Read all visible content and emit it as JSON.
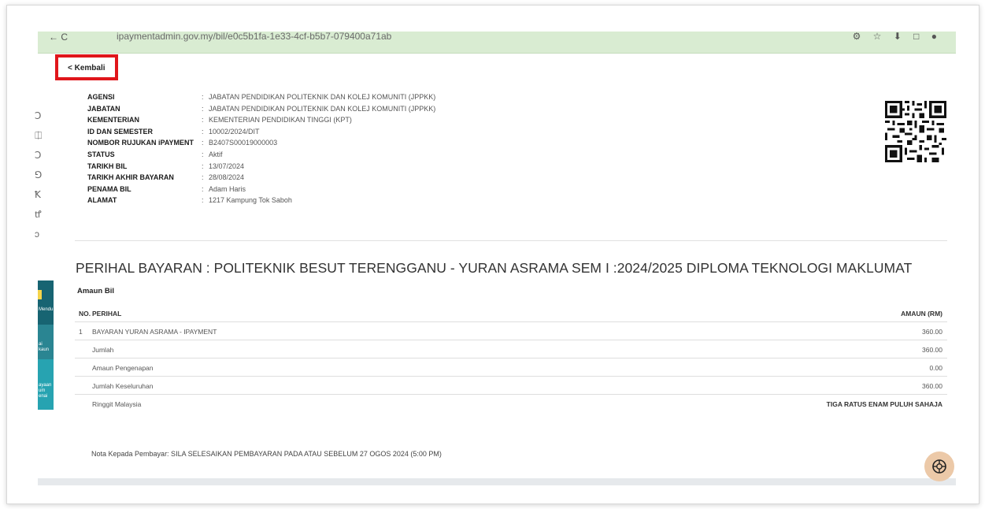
{
  "browser": {
    "nav_left": "←  C",
    "url": "ipaymentadmin.gov.my/bil/e0c5b1fa-1e33-4cf-b5b7-079400a71ab",
    "toolbar_right": "⚙ ☆ ⬇ □ ●"
  },
  "sidebar": {
    "icons": [
      "Ↄ",
      "⎅",
      "Ↄ",
      "⅁",
      "Ꝁ",
      "ꝷ",
      "ↄ"
    ],
    "panel_labels": [
      "Mendu",
      "ai\nkaun",
      "ayaan\num\nenai"
    ]
  },
  "back": {
    "label": "Kembali",
    "icon": "chevron-left-icon"
  },
  "info": [
    {
      "label": "AGENSI",
      "value": "JABATAN PENDIDIKAN POLITEKNIK DAN KOLEJ KOMUNITI (JPPKK)"
    },
    {
      "label": "JABATAN",
      "value": "JABATAN PENDIDIKAN POLITEKNIK DAN KOLEJ KOMUNITI (JPPKK)"
    },
    {
      "label": "KEMENTERIAN",
      "value": "KEMENTERIAN PENDIDIKAN TINGGI (KPT)"
    },
    {
      "label": "ID DAN SEMESTER",
      "value": "10002/2024/DIT"
    },
    {
      "label": "NOMBOR RUJUKAN iPAYMENT",
      "value": "B2407S00019000003"
    },
    {
      "label": "STATUS",
      "value": "Aktif"
    },
    {
      "label": "TARIKH BIL",
      "value": "13/07/2024"
    },
    {
      "label": "TARIKH AKHIR BAYARAN",
      "value": "28/08/2024"
    },
    {
      "label": "PENAMA BIL",
      "value": "Adam Haris"
    },
    {
      "label": "ALAMAT",
      "value": "1217 Kampung Tok Saboh"
    }
  ],
  "perihal_title": "PERIHAL BAYARAN : POLITEKNIK BESUT TERENGGANU - YURAN ASRAMA SEM I :2024/2025 DIPLOMA TEKNOLOGI MAKLUMAT",
  "amaun_bil_label": "Amaun Bil",
  "table": {
    "headers": {
      "no": "NO.",
      "perihal": "PERIHAL",
      "amaun": "AMAUN (RM)"
    },
    "rows": [
      {
        "no": "1",
        "perihal": "BAYARAN YURAN ASRAMA - IPAYMENT",
        "amaun": "360.00",
        "bold_amount": false
      },
      {
        "no": "",
        "perihal": "Jumlah",
        "amaun": "360.00",
        "bold_amount": false
      },
      {
        "no": "",
        "perihal": "Amaun Pengenapan",
        "amaun": "0.00",
        "bold_amount": false
      },
      {
        "no": "",
        "perihal": "Jumlah Keseluruhan",
        "amaun": "360.00",
        "bold_amount": false
      },
      {
        "no": "",
        "perihal": "Ringgit Malaysia",
        "amaun": "TIGA RATUS ENAM PULUH SAHAJA",
        "bold_amount": true
      }
    ]
  },
  "nota": "Nota Kepada Pembayar: SILA SELESAIKAN PEMBAYARAN PADA ATAU SEBELUM 27 OGOS 2024 (5:00 PM)",
  "fab": {
    "icon": "accessibility-icon"
  },
  "colors": {
    "highlight_box": "#e0161b",
    "fab_bg": "#ecc9a8",
    "browser_bar": "#d9ecd2"
  }
}
